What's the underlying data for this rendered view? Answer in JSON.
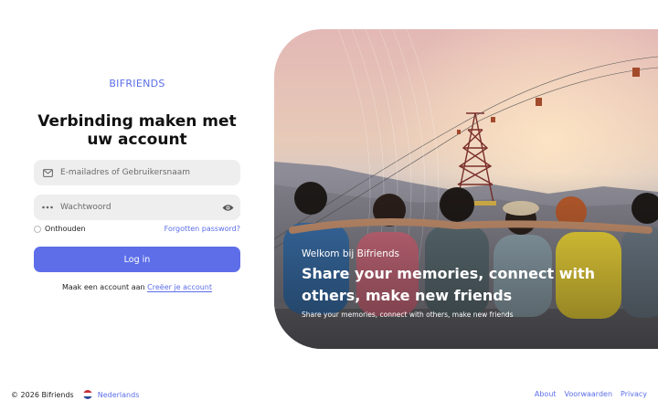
{
  "brand": "BIFRIENDS",
  "login": {
    "title": "Verbinding maken met uw account",
    "email_placeholder": "E-mailadres of Gebruikersnaam",
    "password_placeholder": "Wachtwoord",
    "remember_label": "Onthouden",
    "forgot_label": "Forgotten password?",
    "submit_label": "Log in",
    "signup_prompt": "Maak een account aan",
    "signup_link": "Creëer je account"
  },
  "hero": {
    "kicker": "Welkom bij Bifriends",
    "title": "Share your memories, connect with others, make new friends",
    "subtitle": "Share your memories, connect with others, make new friends"
  },
  "footer": {
    "copyright": "© 2026 Bifriends",
    "language": "Nederlands",
    "links": [
      "About",
      "Voorwaarden",
      "Privacy"
    ]
  },
  "colors": {
    "accent": "#5d6ee8",
    "field_bg": "#eeeeee"
  },
  "icons": {
    "email": "envelope-icon",
    "password": "password-dots-icon",
    "reveal": "eye-icon",
    "language": "netherlands-flag-icon"
  }
}
